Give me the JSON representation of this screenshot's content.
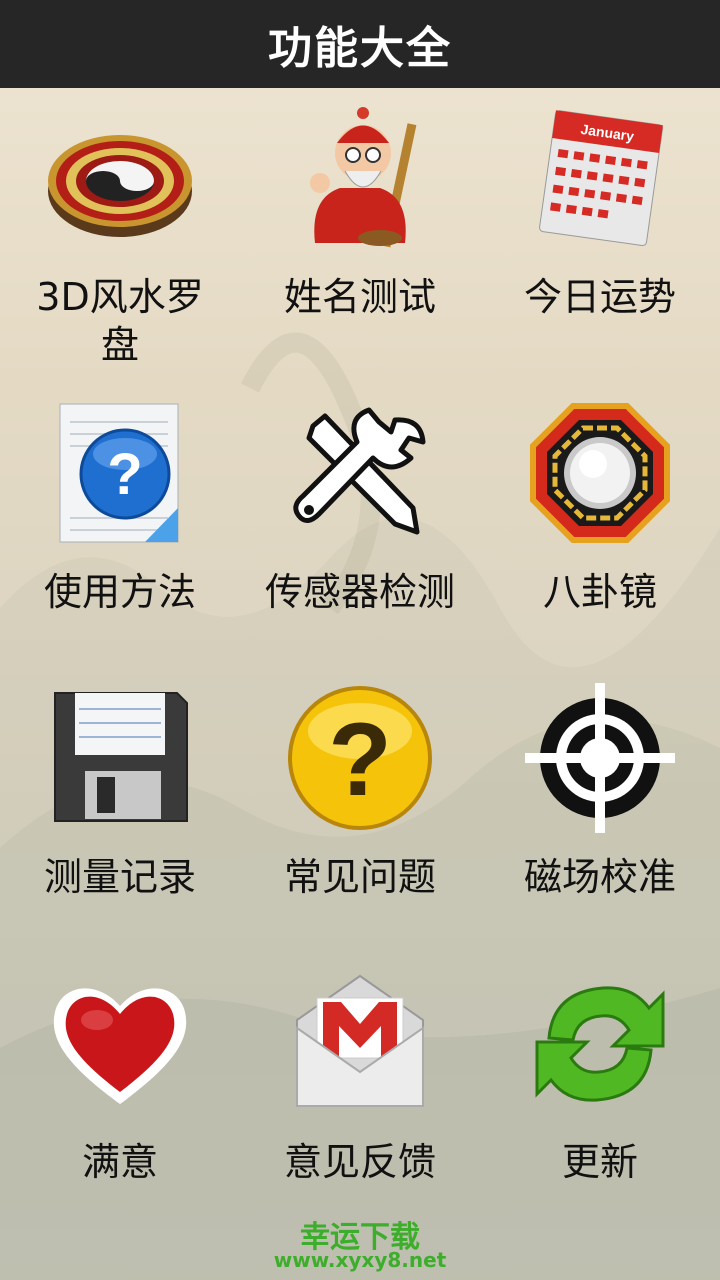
{
  "header": {
    "title": "功能大全"
  },
  "items": [
    {
      "label": "3D风水罗盘",
      "icon": "luopan-compass-icon"
    },
    {
      "label": "姓名测试",
      "icon": "old-sage-icon"
    },
    {
      "label": "今日运势",
      "icon": "calendar-icon"
    },
    {
      "label": "使用方法",
      "icon": "help-document-icon"
    },
    {
      "label": "传感器检测",
      "icon": "tools-wrench-screwdriver-icon"
    },
    {
      "label": "八卦镜",
      "icon": "bagua-mirror-icon"
    },
    {
      "label": "测量记录",
      "icon": "floppy-disk-icon"
    },
    {
      "label": "常见问题",
      "icon": "question-mark-icon"
    },
    {
      "label": "磁场校准",
      "icon": "crosshair-target-icon"
    },
    {
      "label": "满意",
      "icon": "heart-icon"
    },
    {
      "label": "意见反馈",
      "icon": "mail-envelope-icon"
    },
    {
      "label": "更新",
      "icon": "refresh-arrows-icon"
    }
  ],
  "calendar": {
    "month": "January"
  },
  "watermark": {
    "line1": "幸运下载",
    "line2": "www.xyxy8.net"
  }
}
